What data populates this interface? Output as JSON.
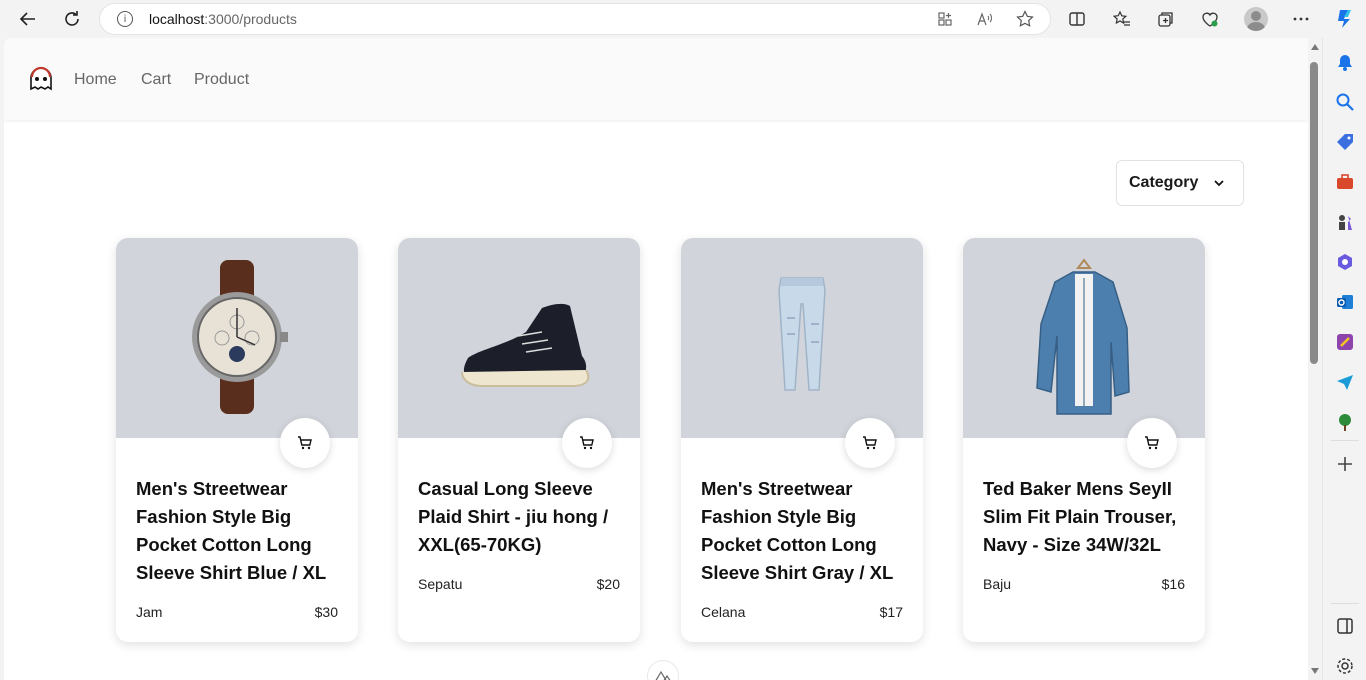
{
  "browser": {
    "url_host": "localhost",
    "url_path": ":3000/products"
  },
  "navbar": {
    "links": [
      "Home",
      "Cart",
      "Product"
    ]
  },
  "filter": {
    "category_label": "Category"
  },
  "products": [
    {
      "title": "Men's Streetwear Fashion Style Big Pocket Cotton Long Sleeve Shirt Blue / XL",
      "category": "Jam",
      "price": "$30",
      "image": "wristwatch"
    },
    {
      "title": "Casual Long Sleeve Plaid Shirt - jiu hong / XXL(65-70KG)",
      "category": "Sepatu",
      "price": "$20",
      "image": "sneaker"
    },
    {
      "title": "Men's Streetwear Fashion Style Big Pocket Cotton Long Sleeve Shirt Gray / XL",
      "category": "Celana",
      "price": "$17",
      "image": "jeans"
    },
    {
      "title": "Ted Baker Mens SeyII Slim Fit Plain Trouser, Navy - Size 34W/32L",
      "category": "Baju",
      "price": "$16",
      "image": "denim-shirt"
    }
  ],
  "colors": {
    "card_image_bg": "#d1d5db",
    "nav_bg": "#fafafa",
    "accent_edge": "#1a73e8"
  }
}
